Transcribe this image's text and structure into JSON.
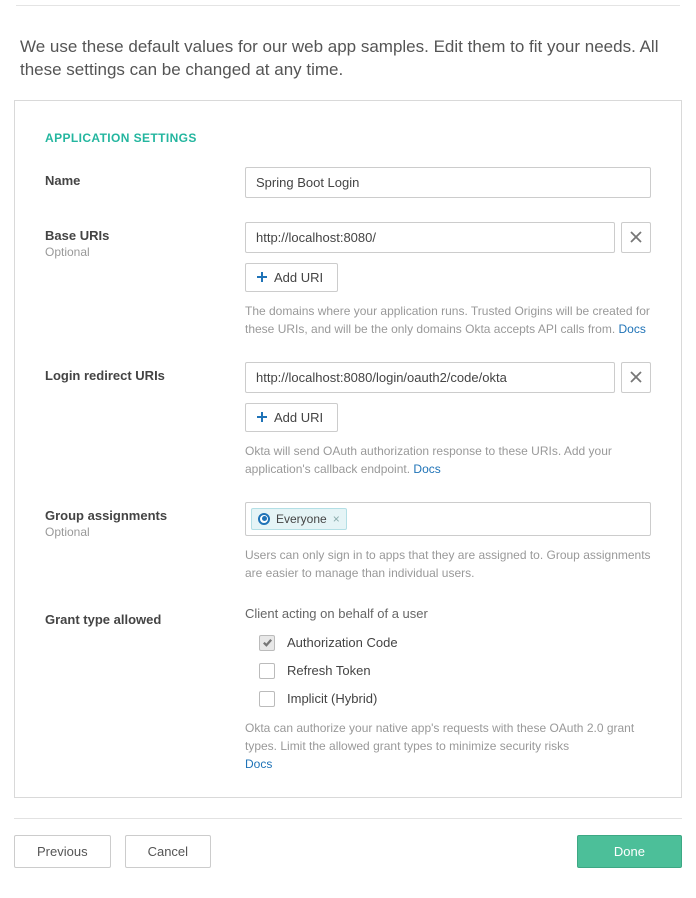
{
  "intro": "We use these default values for our web app samples. Edit them to fit your needs. All these settings can be changed at any time.",
  "section_title": "APPLICATION SETTINGS",
  "name": {
    "label": "Name",
    "value": "Spring Boot Login"
  },
  "base_uris": {
    "label": "Base URIs",
    "optional": "Optional",
    "value": "http://localhost:8080/",
    "add_label": "Add URI",
    "help_pre": "The domains where your application runs. Trusted Origins will be created for these URIs, and will be the only domains Okta accepts API calls from. ",
    "docs": "Docs"
  },
  "login_redirect": {
    "label": "Login redirect URIs",
    "value": "http://localhost:8080/login/oauth2/code/okta",
    "add_label": "Add URI",
    "help_pre": "Okta will send OAuth authorization response to these URIs. Add your application's callback endpoint. ",
    "docs": "Docs"
  },
  "group": {
    "label": "Group assignments",
    "optional": "Optional",
    "chip": "Everyone",
    "help": "Users can only sign in to apps that they are assigned to. Group assignments are easier to manage than individual users."
  },
  "grant": {
    "label": "Grant type allowed",
    "subhead": "Client acting on behalf of a user",
    "auth_code": "Authorization Code",
    "refresh": "Refresh Token",
    "implicit": "Implicit (Hybrid)",
    "help_pre": "Okta can authorize your native app's requests with these OAuth 2.0 grant types. Limit the allowed grant types to minimize security risks ",
    "docs": "Docs"
  },
  "footer": {
    "previous": "Previous",
    "cancel": "Cancel",
    "done": "Done"
  }
}
